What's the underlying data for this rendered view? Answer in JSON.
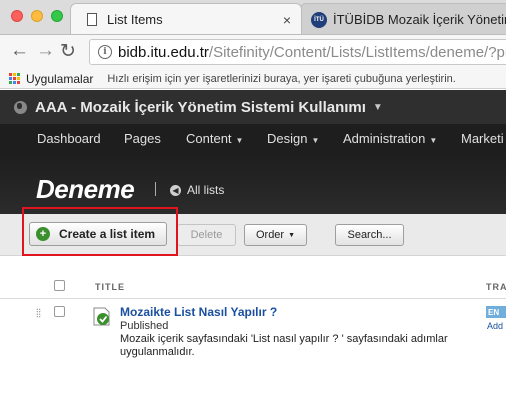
{
  "browser": {
    "tabs": [
      {
        "title": "List Items",
        "close": "×",
        "active": true
      },
      {
        "title": "İTÜBİDB Mozaik İçerik Yönetim",
        "badge": "İTÜ",
        "active": false
      }
    ],
    "url": {
      "host": "bidb.itu.edu.tr",
      "path": "/Sitefinity/Content/Lists/ListItems/deneme/?pro"
    },
    "bookmarks": {
      "apps_label": "Uygulamalar",
      "hint": "Hızlı erişim için yer işaretlerinizi buraya, yer işareti çubuğuna yerleştirin."
    }
  },
  "header": {
    "site_title": "AAA - Mozaik İçerik Yönetim Sistemi Kullanımı",
    "nav": [
      {
        "label": "Dashboard",
        "dropdown": false
      },
      {
        "label": "Pages",
        "dropdown": false
      },
      {
        "label": "Content",
        "dropdown": true
      },
      {
        "label": "Design",
        "dropdown": true
      },
      {
        "label": "Administration",
        "dropdown": true
      },
      {
        "label": "Marketi",
        "dropdown": false
      }
    ]
  },
  "page": {
    "title": "Deneme",
    "back_link": "All lists"
  },
  "toolbar": {
    "create_label": "Create a list item",
    "delete_label": "Delete",
    "order_label": "Order",
    "search_label": "Search..."
  },
  "grid": {
    "columns": {
      "title": "TITLE",
      "translations": "TRA"
    },
    "rows": [
      {
        "title": "Mozaikte List Nasıl Yapılır ?",
        "status": "Published",
        "description": "Mozaik içerik sayfasındaki 'List nasıl yapılır ? ' sayfasındaki adımlar uygulanmalıdır.",
        "language": "EN",
        "add_label": "Add"
      }
    ]
  },
  "colors": {
    "accent_green": "#3c8f2e",
    "link_blue": "#1a4f9f",
    "highlight_red": "#e0141e",
    "header_dark": "#1e1e1e"
  },
  "icons": {
    "tab": "document-icon",
    "address": "info-icon",
    "apps": "apps-grid-icon",
    "site": "globe-icon",
    "create": "plus-icon",
    "status": "published-check-icon"
  }
}
